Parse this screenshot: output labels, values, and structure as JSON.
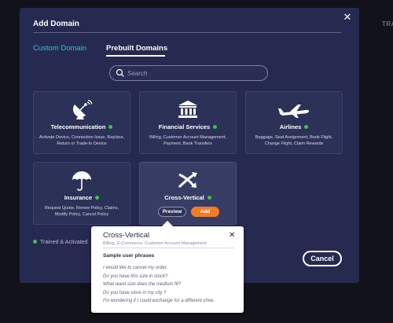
{
  "background": {
    "tab_fragment": "TRA"
  },
  "modal": {
    "title": "Add Domain",
    "tabs": [
      {
        "label": "Custom Domain"
      },
      {
        "label": "Prebuilt Domains"
      }
    ],
    "search": {
      "placeholder": "Search",
      "value": ""
    },
    "cards": [
      {
        "name": "Telecommunication",
        "description": "Activate Device, Connection Issue, Replace, Return or Trade-In Device",
        "icon": "satellite-dish-icon"
      },
      {
        "name": "Financial Services",
        "description": "Billing, Customer Account Management, Payment, Bank Transfers",
        "icon": "bank-icon"
      },
      {
        "name": "Airlines",
        "description": "Baggage, Seat Assignment, Book Flight, Change Flight, Claim Rewards",
        "icon": "airplane-icon"
      },
      {
        "name": "Insurance",
        "description": "Request Quote, Renew Policy, Claims, Modify Policy, Cancel Policy",
        "icon": "umbrella-icon"
      },
      {
        "name": "Cross-Vertical",
        "description": "",
        "icon": "crossing-arrows-icon",
        "preview_label": "Preview",
        "add_label": "Add"
      }
    ],
    "legend": "Trained & Activated",
    "cancel_label": "Cancel",
    "colors": {
      "accent": "#2fc1e0",
      "add": "#f47b26",
      "status": "#3fc14b",
      "modal_bg": "#262a50"
    }
  },
  "popover": {
    "title": "Cross-Vertical",
    "subtitle": "Billing, E-Commerce, Customer Account Management",
    "heading": "Sample user phrases",
    "phrases": [
      "I would like to cancel my order.",
      "Do you have this size in stock?",
      "What waist size does the medium fit?",
      "Do you have store in my city ?",
      "I'm wondering if I could exchange for a different shoe."
    ]
  }
}
